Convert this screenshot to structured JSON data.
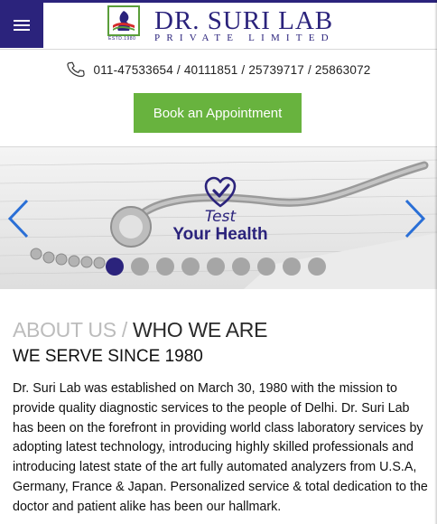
{
  "brand": {
    "title": "DR. SURI LAB",
    "subtitle": "PRIVATE LIMITED",
    "estd": "ESTD.1980"
  },
  "colors": {
    "primary": "#2b237c",
    "accent_green": "#68b33e",
    "muted": "#bcbcbc"
  },
  "header": {
    "menu_icon": "hamburger-icon",
    "phone_icon": "phone-icon",
    "phone_numbers": "011-47533654 / 40111851 / 25739717 / 25863072",
    "appointment_label": "Book an Appointment"
  },
  "slider": {
    "tagline_line1": "Test",
    "tagline_line2": "Your Health",
    "slide_count": 9,
    "active_slide": 1,
    "prev_icon": "chevron-left-icon",
    "next_icon": "chevron-right-icon"
  },
  "about": {
    "label_light": "ABOUT US",
    "separator": "/",
    "label_dark": "WHO WE ARE",
    "subheading": "WE SERVE SINCE 1980",
    "body": "Dr. Suri Lab was established on March 30, 1980 with the mission to provide quality diagnostic services to the people of Delhi. Dr. Suri Lab has been on the forefront in providing world class laboratory services by adopting latest technology, introducing highly skilled professionals and introducing latest state of the art fully automated analyzers from U.S.A, Germany, France & Japan. Personalized service & total dedication to the doctor and patient alike has been our hallmark."
  }
}
